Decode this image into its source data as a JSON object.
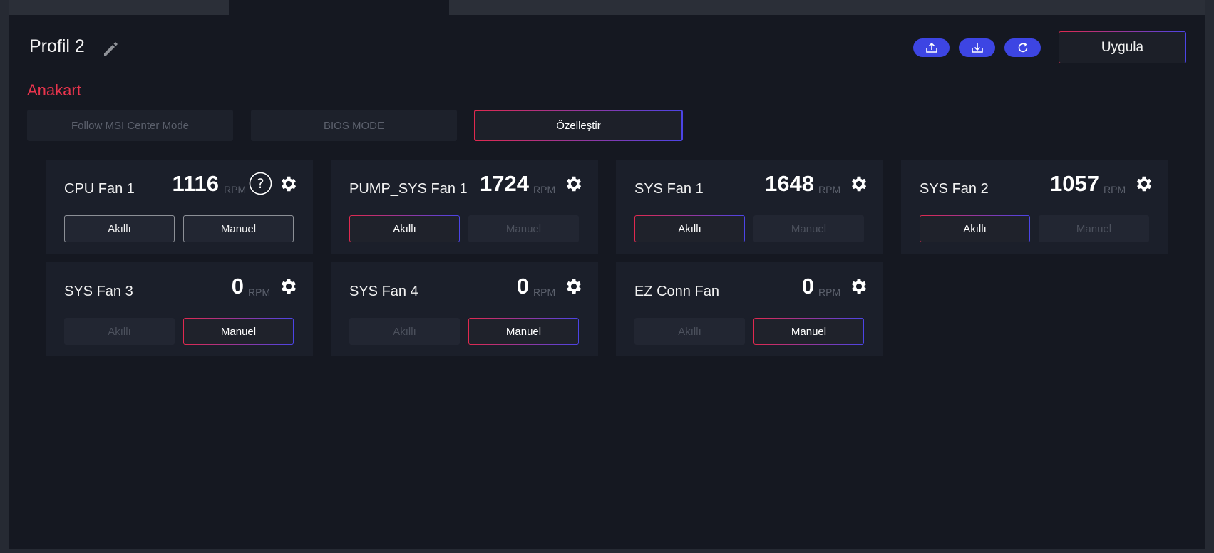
{
  "header": {
    "profile_title": "Profil 2",
    "icon_buttons": [
      "export-icon",
      "import-icon",
      "reset-icon"
    ],
    "apply_label": "Uygula"
  },
  "section": {
    "title": "Anakart"
  },
  "modes": [
    {
      "label": "Follow MSI Center Mode",
      "active": false
    },
    {
      "label": "BIOS MODE",
      "active": false
    },
    {
      "label": "Özelleştir",
      "active": true
    }
  ],
  "fans": [
    {
      "name": "CPU Fan 1",
      "rpm": "1116",
      "unit": "RPM",
      "smart_label": "Akıllı",
      "manual_label": "Manuel",
      "help": true
    },
    {
      "name": "PUMP_SYS Fan 1",
      "rpm": "1724",
      "unit": "RPM",
      "smart_label": "Akıllı",
      "manual_label": "Manuel"
    },
    {
      "name": "SYS Fan 1",
      "rpm": "1648",
      "unit": "RPM",
      "smart_label": "Akıllı",
      "manual_label": "Manuel"
    },
    {
      "name": "SYS Fan 2",
      "rpm": "1057",
      "unit": "RPM",
      "smart_label": "Akıllı",
      "manual_label": "Manuel"
    },
    {
      "name": "SYS Fan 3",
      "rpm": "0",
      "unit": "RPM",
      "smart_label": "Akıllı",
      "manual_label": "Manuel"
    },
    {
      "name": "SYS Fan 4",
      "rpm": "0",
      "unit": "RPM",
      "smart_label": "Akıllı",
      "manual_label": "Manuel"
    },
    {
      "name": "EZ Conn Fan",
      "rpm": "0",
      "unit": "RPM",
      "smart_label": "Akıllı",
      "manual_label": "Manuel"
    }
  ],
  "colors": {
    "accent_red": "#e8344d",
    "accent_blue": "#3d45e3",
    "panel_bg": "#151821",
    "card_bg": "#1b1f2a"
  }
}
